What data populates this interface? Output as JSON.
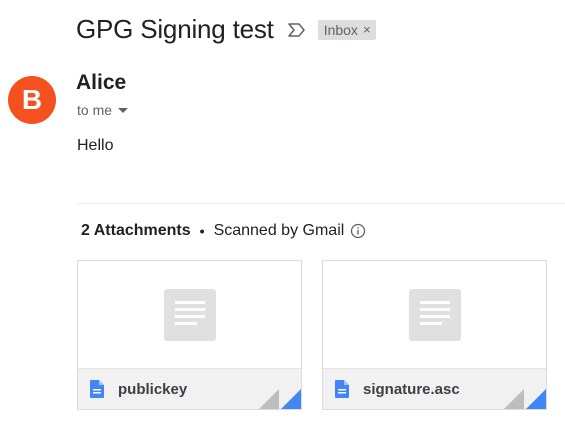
{
  "email": {
    "subject": "GPG Signing test",
    "label": "Inbox",
    "label_remove": "×",
    "sender_initial": "B",
    "sender_name": "Alice",
    "recipient": "to me",
    "body": "Hello"
  },
  "attachments": {
    "count_label": "2 Attachments",
    "bullet": "•",
    "scan_label": "Scanned by Gmail",
    "items": [
      {
        "filename": "publickey"
      },
      {
        "filename": "signature.asc"
      }
    ]
  },
  "colors": {
    "avatar": "#f4511e",
    "file_icon": "#4285f4",
    "label_chip": "#dddddd"
  }
}
